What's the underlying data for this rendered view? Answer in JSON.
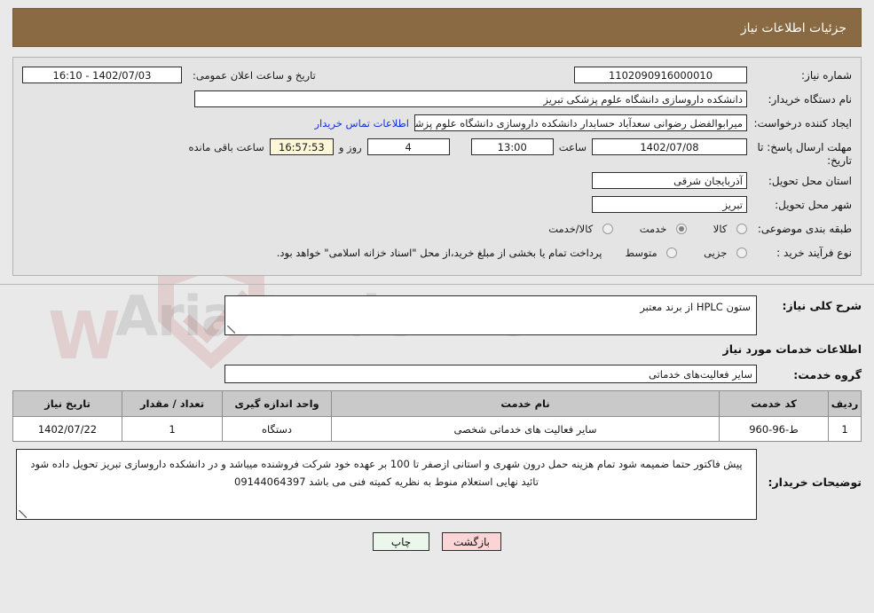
{
  "header": {
    "title": "جزئیات اطلاعات نیاز"
  },
  "form": {
    "need_number_label": "شماره نیاز:",
    "need_number_value": "1102090916000010",
    "announce_label": "تاریخ و ساعت اعلان عمومی:",
    "announce_value": "1402/07/03 - 16:10",
    "buyer_org_label": "نام دستگاه خریدار:",
    "buyer_org_value": "دانشکده داروسازی دانشگاه علوم پزشکی تبریز",
    "requester_label": "ایجاد کننده درخواست:",
    "requester_value": "میرابوالفضل رضوانی سعدآباد حسابدار دانشکده داروسازی دانشگاه علوم پزشکی",
    "contact_link": "اطلاعات تماس خریدار",
    "deadline_label": "مهلت ارسال پاسخ: تا تاریخ:",
    "deadline_date": "1402/07/08",
    "deadline_hour_label": "ساعت",
    "deadline_hour": "13:00",
    "days_remaining": "4",
    "days_unit_label": "روز و",
    "time_remaining": "16:57:53",
    "time_remaining_label": "ساعت باقی مانده",
    "province_label": "استان محل تحویل:",
    "province_value": "آذربایجان شرقی",
    "city_label": "شهر محل تحویل:",
    "city_value": "تبریز",
    "category_label": "طبقه بندی موضوعی:",
    "category_options": [
      {
        "label": "کالا",
        "selected": false
      },
      {
        "label": "خدمت",
        "selected": true
      },
      {
        "label": "کالا/خدمت",
        "selected": false
      }
    ],
    "process_label": "نوع فرآیند خرید :",
    "process_options": [
      {
        "label": "جزیی",
        "selected": false
      },
      {
        "label": "متوسط",
        "selected": false
      }
    ],
    "process_note": "پرداخت تمام یا بخشی از مبلغ خرید،از محل \"اسناد خزانه اسلامی\" خواهد بود."
  },
  "need_desc": {
    "label": "شرح کلی نیاز:",
    "value": "ستون HPLC از برند معتبر"
  },
  "services_section": {
    "heading": "اطلاعات خدمات مورد نیاز",
    "group_label": "گروه خدمت:",
    "group_value": "سایر فعالیت‌های خدماتی"
  },
  "table": {
    "headers": [
      "ردیف",
      "کد خدمت",
      "نام خدمت",
      "واحد اندازه گیری",
      "تعداد / مقدار",
      "تاریخ نیاز"
    ],
    "rows": [
      {
        "row": "1",
        "code": "ط-96-960",
        "name": "سایر فعالیت های خدماتی شخصی",
        "unit": "دستگاه",
        "qty": "1",
        "date": "1402/07/22"
      }
    ]
  },
  "buyer_notes": {
    "label": "توضیحات خریدار:",
    "value": "پیش فاکتور حتما ضمیمه شود تمام هزینه حمل درون شهری و استانی ازصفر تا 100 بر عهده خود شرکت فروشنده میباشد  و در دانشکده داروسازی تبریز تحویل داده شود تائید نهایی استعلام منوط به نظریه کمیته فنی می باشد 09144064397"
  },
  "footer": {
    "back_label": "بازگشت",
    "print_label": "چاپ"
  },
  "watermark": {
    "text": "AriaTender.net"
  }
}
